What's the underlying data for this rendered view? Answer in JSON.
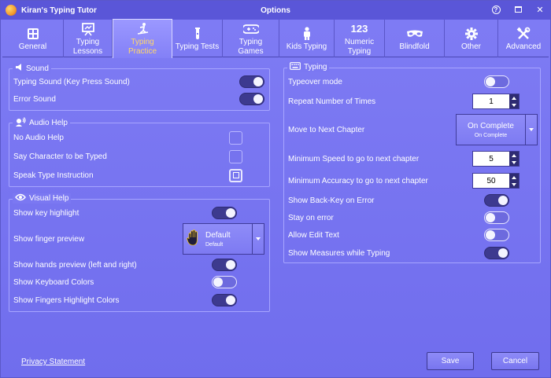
{
  "window": {
    "app_title": "Kiran's Typing Tutor",
    "title": "Options",
    "controls": [
      "help-icon",
      "maximize-icon",
      "close-icon"
    ]
  },
  "tabs": [
    {
      "label": "General",
      "icon": "keyboard-grid-icon",
      "active": false
    },
    {
      "label": "Typing Lessons",
      "icon": "presentation-board-icon",
      "active": false
    },
    {
      "label": "Typing Practice",
      "icon": "skier-icon",
      "active": true
    },
    {
      "label": "Typing Tests",
      "icon": "test-tube-icon",
      "active": false
    },
    {
      "label": "Typing Games",
      "icon": "gamepad-icon",
      "active": false
    },
    {
      "label": "Kids Typing",
      "icon": "child-icon",
      "active": false
    },
    {
      "label": "Numeric Typing",
      "icon": "numbers-123-icon",
      "active": false
    },
    {
      "label": "Blindfold",
      "icon": "blindfold-mask-icon",
      "active": false
    },
    {
      "label": "Other",
      "icon": "gear-icon",
      "active": false
    },
    {
      "label": "Advanced",
      "icon": "tools-icon",
      "active": false
    }
  ],
  "sound": {
    "title": "Sound",
    "items": [
      {
        "label": "Typing Sound (Key Press Sound)",
        "on": true
      },
      {
        "label": "Error Sound",
        "on": true
      }
    ]
  },
  "audio_help": {
    "title": "Audio Help",
    "items": [
      {
        "label": "No Audio Help",
        "checked": false
      },
      {
        "label": "Say Character to be Typed",
        "checked": false
      },
      {
        "label": "Speak Type Instruction",
        "checked": false,
        "focused": true
      }
    ]
  },
  "visual_help": {
    "title": "Visual Help",
    "show_key_highlight": {
      "label": "Show key highlight",
      "on": true
    },
    "finger_preview": {
      "label": "Show finger preview",
      "value": "Default",
      "sub": "Default"
    },
    "hands_preview": {
      "label": "Show hands preview (left and right)",
      "on": true
    },
    "keyboard_colors": {
      "label": "Show Keyboard Colors",
      "on": false
    },
    "finger_colors": {
      "label": "Show Fingers Highlight Colors",
      "on": true
    }
  },
  "typing": {
    "title": "Typing",
    "typeover": {
      "label": "Typeover mode",
      "on": false
    },
    "repeat": {
      "label": "Repeat Number of Times",
      "value": "1"
    },
    "next_chapter": {
      "label": "Move to Next Chapter",
      "value": "On Complete",
      "sub": "On Complete"
    },
    "min_speed": {
      "label": "Minimum Speed to go to next chapter",
      "value": "5"
    },
    "min_accuracy": {
      "label": "Minimum Accuracy to go to next chapter",
      "value": "50"
    },
    "backkey": {
      "label": "Show Back-Key on Error",
      "on": true
    },
    "stay_error": {
      "label": "Stay on error",
      "on": false
    },
    "allow_edit": {
      "label": "Allow Edit Text",
      "on": false
    },
    "show_measures": {
      "label": "Show Measures while Typing",
      "on": true
    }
  },
  "footer": {
    "privacy": "Privacy Statement",
    "save": "Save",
    "cancel": "Cancel"
  }
}
